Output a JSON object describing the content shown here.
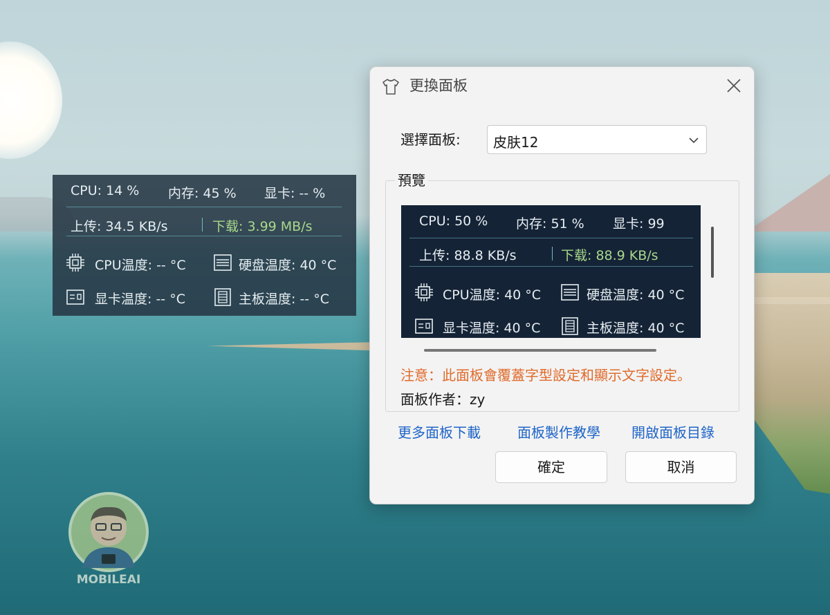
{
  "monitor": {
    "cpu": "CPU: 14 %",
    "mem": "内存: 45 %",
    "gpu": "显卡: -- %",
    "upload": "上传: 34.5 KB/s",
    "download": "下载: 3.99 MB/s",
    "cpu_temp": "CPU温度: -- °C",
    "disk_temp": "硬盘温度: 40 °C",
    "gpu_temp": "显卡温度: -- °C",
    "board_temp": "主板温度: -- °C"
  },
  "dialog": {
    "title": "更換面板",
    "select_label": "選擇面板:",
    "select_value": "皮肤12",
    "preview_label": "預覽",
    "note": "注意：此面板會覆蓋字型設定和顯示文字設定。",
    "author": "面板作者：zy",
    "links": [
      "更多面板下載",
      "面板製作教學",
      "開啟面板目錄"
    ],
    "ok": "確定",
    "cancel": "取消"
  },
  "preview": {
    "cpu": "CPU: 50 %",
    "mem": "内存: 51 %",
    "gpu": "显卡: 99",
    "upload": "上传: 88.8 KB/s",
    "download": "下载: 88.9 KB/s",
    "cpu_temp": "CPU温度: 40 °C",
    "disk_temp": "硬盘温度: 40 °C",
    "gpu_temp": "显卡温度: 40 °C",
    "board_temp": "主板温度: 40 °C"
  },
  "logo": {
    "text": "MOBILEAI"
  },
  "colors": {
    "link": "#1e64c8",
    "note": "#e06a2a",
    "download": "#a9d98a",
    "monitor_bg": "#263744",
    "preview_bg": "#152336"
  }
}
